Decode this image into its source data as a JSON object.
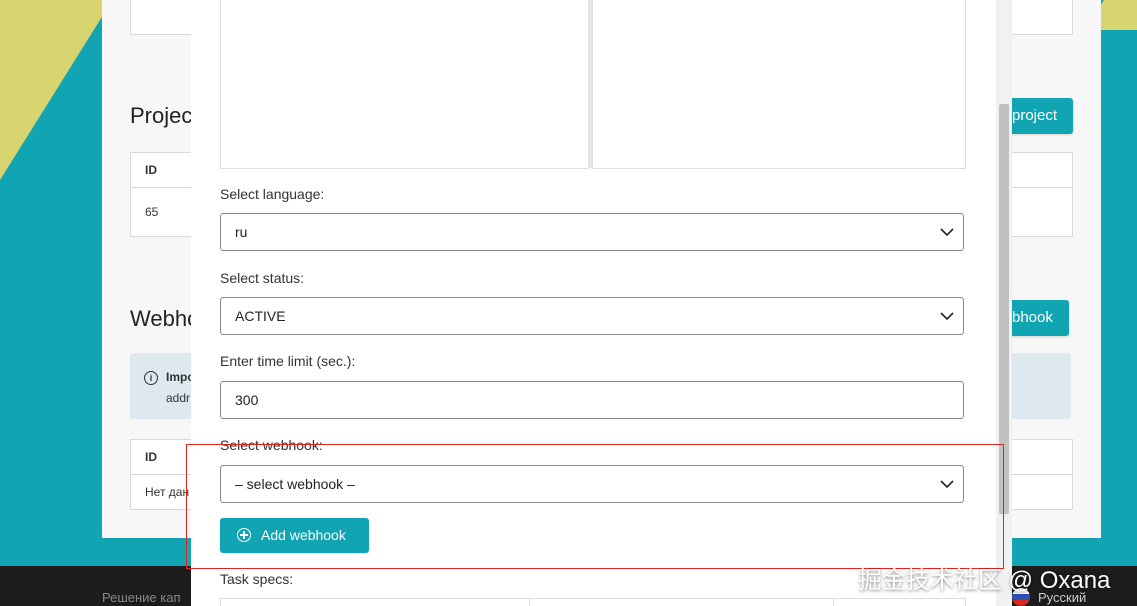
{
  "background": {
    "projects_title": "Projec",
    "projects_button": "project",
    "projects_table": {
      "header_id": "ID",
      "rows": [
        {
          "id": "65"
        }
      ]
    },
    "webhooks_title": "Webhc",
    "webhooks_button": "bhook",
    "alert": {
      "title": "Impo",
      "text": "addr"
    },
    "webhooks_table": {
      "header_id": "ID",
      "empty_text": "Нет дан"
    },
    "footer": {
      "text": "Решение кап",
      "language": "Русский"
    }
  },
  "modal": {
    "language": {
      "label": "Select language:",
      "value": "ru"
    },
    "status": {
      "label": "Select status:",
      "value": "ACTIVE"
    },
    "time_limit": {
      "label": "Enter time limit (sec.):",
      "value": "300"
    },
    "webhook": {
      "label": "Select webhook:",
      "value": "– select webhook –"
    },
    "add_webhook_button": "Add webhook",
    "task_specs_label": "Task specs:"
  },
  "watermark": "掘金技术社区 @ Oxana",
  "colors": {
    "accent": "#11a5b3",
    "highlight": "#e0241b",
    "stripe": "#d8d470"
  }
}
